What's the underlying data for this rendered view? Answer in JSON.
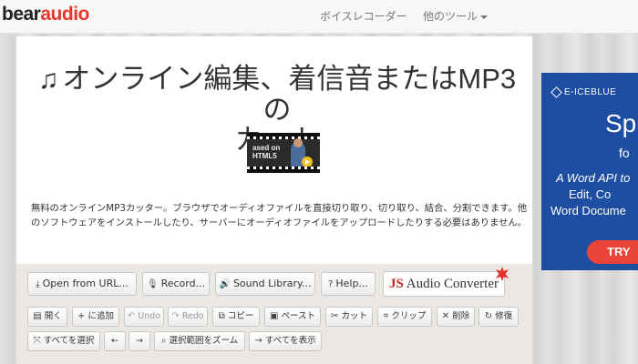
{
  "brand": {
    "part1": "bear",
    "part2": "audio"
  },
  "nav": {
    "voice_recorder": "ボイスレコーダー",
    "other_tools": "他のツール"
  },
  "hero": {
    "title_line1": "オンライン編集、着信音またはMP3の",
    "title_line2": "カット",
    "video_text_1": "ased on",
    "video_text_2": "HTML5",
    "description": "無料のオンラインMP3カッター。ブラウザでオーディオファイルを直接切り取り、切り取り、結合、分割できます。他のソフトウェアをインストールしたり、サーバーにオーディオファイルをアップロードしたりする必要はありません。"
  },
  "ad": {
    "brand": "E-ICEBLUE",
    "big_text": "Spi",
    "small_text": "fo",
    "line1": "A Word API to",
    "line2": "Edit, Co",
    "line3": "Word Docume",
    "cta": "TRY"
  },
  "toolbar_main": {
    "open_url": "Open from URL...",
    "record": "Record...",
    "sound_library": "Sound Library...",
    "help": "Help...",
    "js_part": "JS",
    "converter_part": "Audio Converter"
  },
  "toolbar_edit": {
    "open": "開く",
    "append": "に追加",
    "undo": "Undo",
    "redo": "Redo",
    "copy": "コピー",
    "paste": "ペースト",
    "cut": "カット",
    "clip": "クリップ",
    "delete": "削除",
    "repair": "修復"
  },
  "toolbar_view": {
    "select_all": "すべてを選択",
    "left_arrow": "←",
    "right_arrow": "→",
    "zoom_selection": "選択範囲をズーム",
    "show_all": "すべてを表示"
  },
  "colors": {
    "brand_red": "#e8372b",
    "ad_blue": "#1e4ea1",
    "cta_red": "#e9443a"
  }
}
